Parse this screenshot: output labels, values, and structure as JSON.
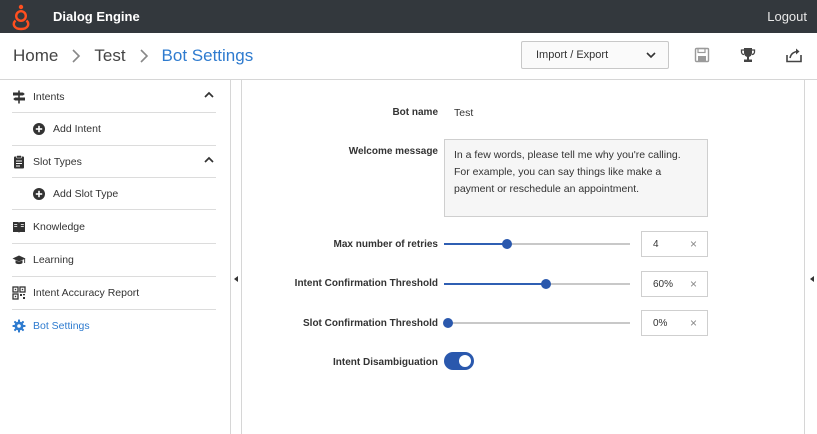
{
  "app": {
    "title": "Dialog Engine",
    "logout": "Logout"
  },
  "breadcrumb": {
    "home": "Home",
    "test": "Test",
    "current": "Bot Settings"
  },
  "toolbar": {
    "import_export": "Import / Export"
  },
  "sidebar": {
    "intents": "Intents",
    "add_intent": "Add Intent",
    "slot_types": "Slot Types",
    "add_slot_type": "Add Slot Type",
    "knowledge": "Knowledge",
    "learning": "Learning",
    "accuracy": "Intent Accuracy Report",
    "bot_settings": "Bot Settings"
  },
  "form": {
    "bot_name_label": "Bot name",
    "bot_name_value": "Test",
    "welcome_label": "Welcome message",
    "welcome_value": "In a few words, please tell me why you're calling. For example, you can say things like make a payment or reschedule an appointment.",
    "retries_label": "Max number of retries",
    "retries_value": "4",
    "retries_fraction": 0.34,
    "intent_threshold_label": "Intent Confirmation Threshold",
    "intent_threshold_value": "60%",
    "intent_threshold_fraction": 0.55,
    "slot_threshold_label": "Slot Confirmation Threshold",
    "slot_threshold_value": "0%",
    "slot_threshold_fraction": 0.02,
    "disambiguation_label": "Intent Disambiguation",
    "disambiguation_on": true,
    "clear_glyph": "×"
  },
  "colors": {
    "topbar": "#33383d",
    "accent": "#2a58ad",
    "link": "#2e7bcf",
    "logo": "#ff4f1f"
  }
}
